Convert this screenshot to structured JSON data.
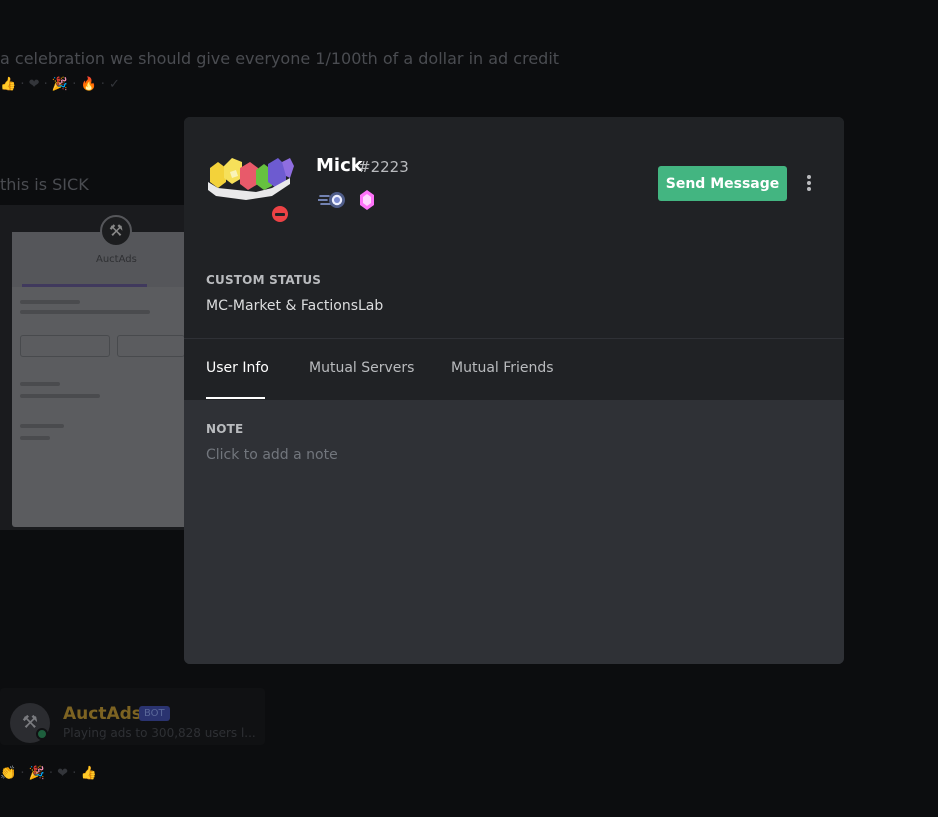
{
  "background": {
    "message1": "a celebration we should give everyone 1/100th of a dollar in ad credit",
    "message2": "this is SICK",
    "embed_title": "AuctAds",
    "bot_name": "AuctAds",
    "bot_tag": "BOT",
    "bot_status": "Playing ads to 300,828 users l..."
  },
  "profile": {
    "username": "Mick",
    "discriminator": "#2223",
    "status": "dnd",
    "badges": [
      "nitro-icon",
      "server-boost-icon"
    ],
    "send_message_label": "Send Message",
    "custom_status_label": "CUSTOM STATUS",
    "custom_status": "MC-Market & FactionsLab",
    "tabs": [
      {
        "label": "User Info",
        "active": true
      },
      {
        "label": "Mutual Servers",
        "active": false
      },
      {
        "label": "Mutual Friends",
        "active": false
      }
    ],
    "note_label": "NOTE",
    "note_placeholder": "Click to add a note"
  },
  "colors": {
    "accent_green": "#43b581",
    "dnd_red": "#ed4245",
    "modal_header": "#202225",
    "modal_body": "#2f3136"
  }
}
